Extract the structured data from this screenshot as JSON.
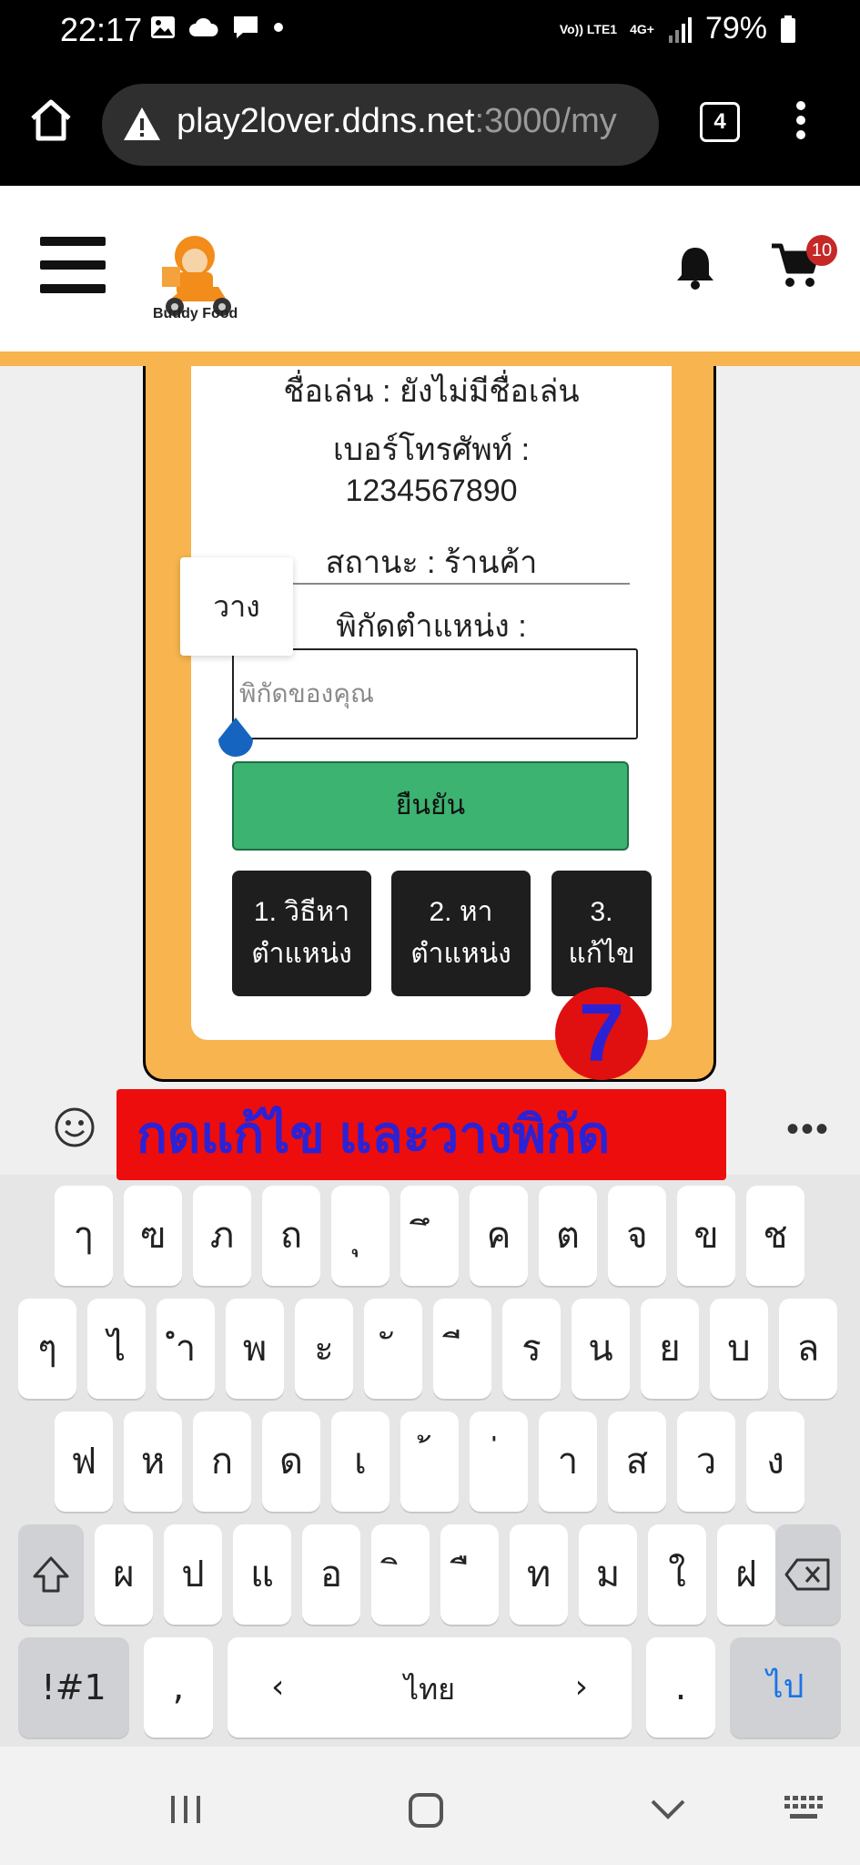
{
  "status_bar": {
    "time": "22:17",
    "network_label": "Vo)) LTE1",
    "network_type": "4G+",
    "battery": "79%"
  },
  "browser": {
    "url_host": "play2lover.ddns.net",
    "url_rest": ":3000/my",
    "tab_count": "4"
  },
  "app": {
    "brand": "Buddy Food",
    "cart_count": "10"
  },
  "profile": {
    "nickname_line": "ชื่อเล่น : ยังไม่มีชื่อเล่น",
    "phone_label": "เบอร์โทรศัพท์ :",
    "phone_value": "1234567890",
    "status_line": "สถานะ : ร้านค้า",
    "coords_label": "พิกัดตำแหน่ง :",
    "coords_placeholder": "พิกัดของคุณ",
    "confirm_label": "ยืนยัน",
    "buttons": [
      "1. วิธีหา\nตำแหน่ง",
      "2. หา\nตำแหน่ง",
      "3.\nแก้ไข"
    ],
    "paste_label": "วาง",
    "step_number": "7"
  },
  "instruction_banner": "กดแก้ไข และวางพิกัด",
  "keyboard": {
    "row1": [
      "ๅ",
      "ฃ",
      "ภ",
      "ถ",
      "ุ",
      "ึ",
      "ค",
      "ต",
      "จ",
      "ข",
      "ช"
    ],
    "row2": [
      "ๆ",
      "ไ",
      "ำ",
      "พ",
      "ะ",
      "ั",
      "ี",
      "ร",
      "น",
      "ย",
      "บ",
      "ล"
    ],
    "row3": [
      "ฟ",
      "ห",
      "ก",
      "ด",
      "เ",
      "้",
      "่",
      "า",
      "ส",
      "ว",
      "ง"
    ],
    "row4": [
      "ผ",
      "ป",
      "แ",
      "อ",
      "ิ",
      "ื",
      "ท",
      "ม",
      "ใ",
      "ฝ"
    ],
    "symbols_key": "!#1",
    "comma_key": ",",
    "space_label": "ไทย",
    "period_key": ".",
    "go_key": "ไป"
  },
  "colors": {
    "accent_orange": "#f7b44f",
    "confirm_green": "#3cb371",
    "banner_red": "#ee0d0d",
    "banner_text": "#2b22d6"
  }
}
